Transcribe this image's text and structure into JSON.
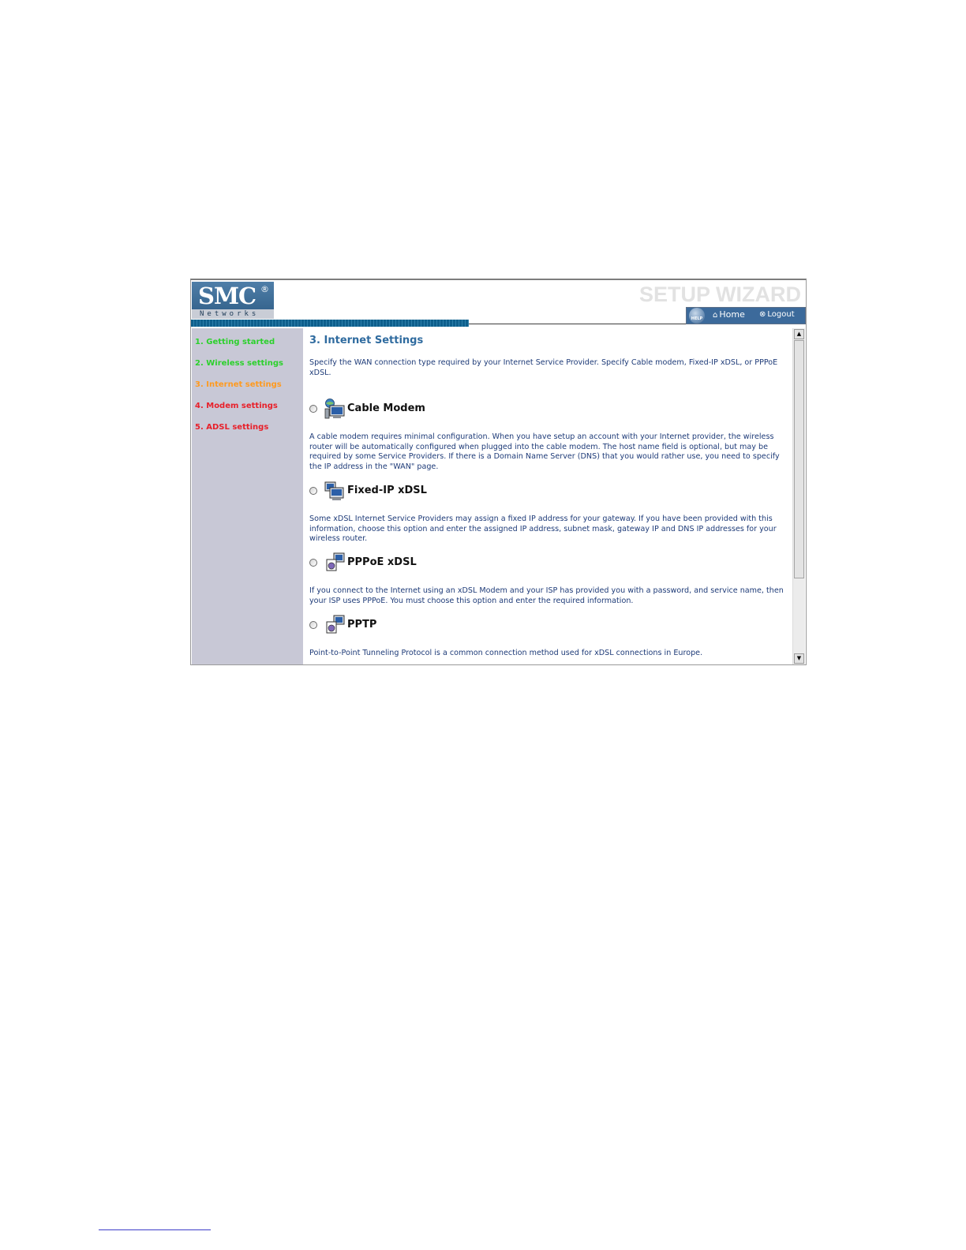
{
  "header": {
    "logo_text": "SMC",
    "logo_registered": "®",
    "logo_sub": "Networks",
    "title": "SETUP WIZARD",
    "help_label": "HELP",
    "home_label": "Home",
    "logout_label": "Logout"
  },
  "sidebar": {
    "items": [
      {
        "label": "1. Getting started",
        "color": "#2cd12c"
      },
      {
        "label": "2. Wireless settings",
        "color": "#2cd12c"
      },
      {
        "label": "3. Internet settings",
        "color": "#ff9a1f"
      },
      {
        "label": "4. Modem settings",
        "color": "#e8202a"
      },
      {
        "label": "5. ADSL settings",
        "color": "#e8202a"
      }
    ]
  },
  "main": {
    "title": "3. Internet Settings",
    "intro": "Specify the WAN connection type required by your Internet Service Provider. Specify Cable modem, Fixed-IP xDSL, or PPPoE xDSL.",
    "options": [
      {
        "label": "Cable Modem",
        "icon": "cable-modem-icon",
        "description": "A cable modem requires minimal configuration. When you have setup an account with your Internet provider, the wireless router will be automatically configured when plugged into the cable modem. The host name field is optional, but may be required by some Service Providers. If there is a Domain Name Server (DNS) that you would rather use, you need to specify the IP address in the \"WAN\" page."
      },
      {
        "label": "Fixed-IP xDSL",
        "icon": "fixed-ip-icon",
        "description": "Some xDSL Internet Service Providers may assign a fixed IP address for your gateway. If you have been provided with this information, choose this option and enter the assigned IP address, subnet mask, gateway IP and DNS IP addresses for your wireless router."
      },
      {
        "label": "PPPoE xDSL",
        "icon": "pppoe-icon",
        "description": "If you connect to the Internet using an xDSL Modem and your ISP has provided you with a password, and service name, then your ISP uses PPPoE. You must choose this option and enter the required information."
      },
      {
        "label": "PPTP",
        "icon": "pptp-icon",
        "description": "Point-to-Point Tunneling Protocol is a common connection method used for xDSL connections in Europe."
      }
    ]
  },
  "scrollbar": {
    "up_glyph": "▲",
    "down_glyph": "▼"
  },
  "colors": {
    "brand_blue": "#2e5d86",
    "title_blue": "#2f6b9f",
    "text_blue": "#1e3b78",
    "sidebar_bg": "#c8c8d6"
  }
}
